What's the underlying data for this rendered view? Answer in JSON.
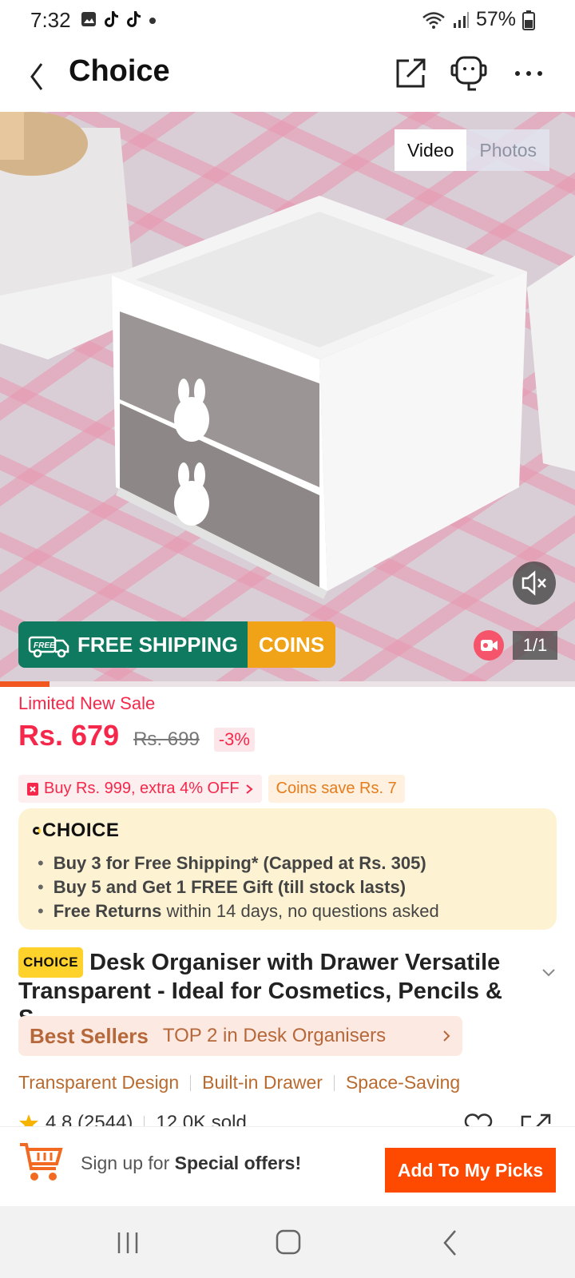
{
  "status_bar": {
    "time": "7:32",
    "battery": "57%"
  },
  "header": {
    "title": "Choice"
  },
  "media": {
    "tab_video": "Video",
    "tab_photos": "Photos",
    "counter": "1/1",
    "promo_free_tag": "FREE",
    "promo_free_shipping": "FREE SHIPPING",
    "promo_coins": "COINS"
  },
  "price": {
    "sale_label": "Limited New Sale",
    "current": "Rs. 679",
    "original": "Rs. 699",
    "discount": "-3%",
    "offer": "Buy Rs. 999, extra 4% OFF",
    "coins_save": "Coins save Rs. 7"
  },
  "choice_box": {
    "logo": "CHOICE",
    "items": [
      {
        "bold": "Buy 3 for  Free Shipping* (Capped at Rs. 305)",
        "rest": ""
      },
      {
        "bold": "Buy 5 and Get 1 FREE Gift (till stock lasts)",
        "rest": ""
      },
      {
        "bold": "Free Returns",
        "rest": " within 14 days, no questions asked"
      }
    ]
  },
  "product": {
    "badge": "CHOICE",
    "title": "Desk Organiser with Drawer Versatile Transparent - Ideal for Cosmetics, Pencils & S...",
    "best_sellers": "Best Sellers",
    "ranking": "TOP 2 in Desk Organisers",
    "features": [
      "Transparent Design",
      "Built-in Drawer",
      "Space-Saving"
    ],
    "rating": "4.8 (2544)",
    "sold": "12.0K sold"
  },
  "bottom_bar": {
    "signup_prefix": "Sign up for ",
    "signup_bold": "Special offers!",
    "add_button": "Add To My Picks"
  },
  "colors": {
    "accent_red": "#f5284b",
    "button_orange": "#fe4a00",
    "free_shipping_green": "#0f7a5f",
    "coins_orange": "#f0a317",
    "choice_box_bg": "#fdf3d3"
  }
}
